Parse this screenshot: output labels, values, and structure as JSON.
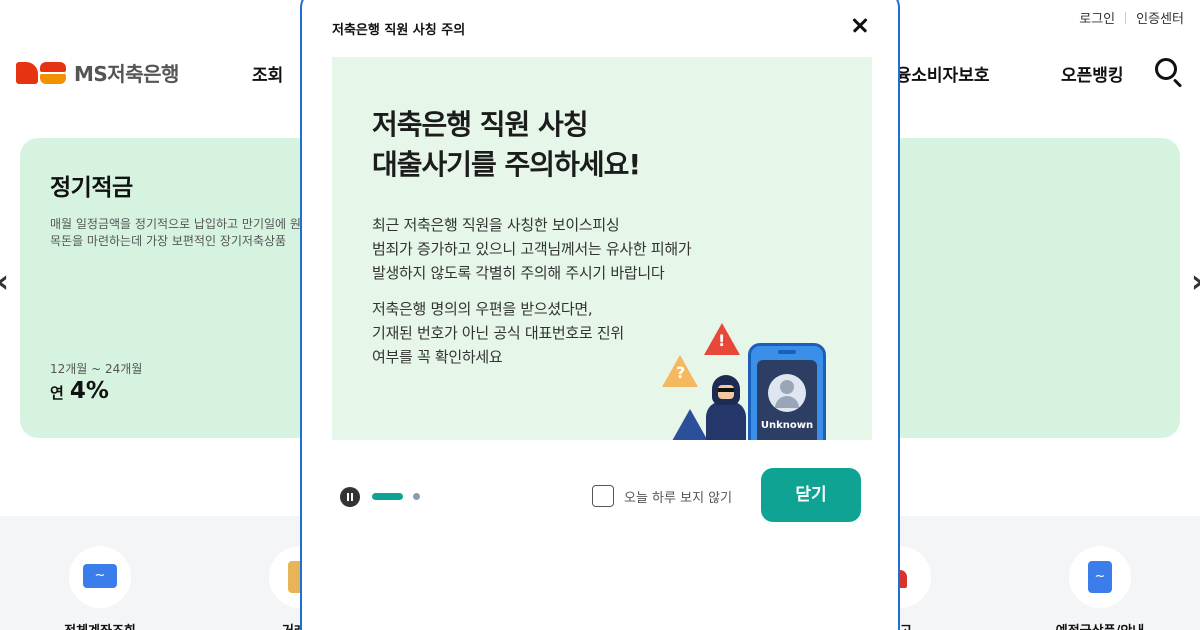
{
  "util_links": {
    "login": "로그인",
    "cert_center": "인증센터"
  },
  "logo": {
    "text": "MS저축은행"
  },
  "nav": {
    "item_inquiry": "조회",
    "item_consumer": "금융소비자보호",
    "item_open_banking": "오픈뱅킹"
  },
  "icons": {
    "search": "search-icon",
    "close": "close-icon",
    "pause": "pause-icon",
    "arrow_left": "chevron-left-icon",
    "arrow_right": "chevron-right-icon"
  },
  "banner": {
    "title": "정기적금",
    "description_line1": "매월 일정금액을 정기적으로 납입하고 만기일에 원",
    "description_line2": "목돈을 마련하는데 가장 보편적인 장기저축상품",
    "period": "12개월 ~ 24개월",
    "rate_label": "연",
    "rate_value": "4%"
  },
  "quick_menu": [
    {
      "label": "전체계좌조회",
      "icon": "account-icon"
    },
    {
      "label": "거래내",
      "icon": "transaction-icon"
    },
    {
      "label": "신고",
      "icon": "siren-icon"
    },
    {
      "label": "예적금상품/안내",
      "icon": "product-guide-icon"
    }
  ],
  "modal": {
    "title": "저축은행 직원 사칭 주의",
    "heading_line1": "저축은행 직원 사칭",
    "heading_line2": "대출사기를 주의하세요!",
    "body_p1_line1": "최근 저축은행 직원을 사칭한 보이스피싱",
    "body_p1_line2": "범죄가 증가하고 있으니 고객님께서는 유사한 피해가",
    "body_p1_line3": "발생하지 않도록 각별히 주의해 주시기 바랍니다",
    "body_p2_line1": "저축은행 명의의 우편을 받으셨다면,",
    "body_p2_line2": "기재된 번호가 아닌 공식 대표번호로 진위",
    "body_p2_line3": "여부를 꼭 확인하세요",
    "phone_label": "Unknown",
    "warn_symbol": "!",
    "question_symbol": "?",
    "no_show_today": "오늘 하루 보지 않기",
    "close_button": "닫기"
  },
  "colors": {
    "accent": "#0fa393",
    "banner_bg": "#d6f3e0",
    "slide_bg": "#e6f7ea",
    "modal_border": "#1f6fd6",
    "brand_red": "#e63312",
    "brand_orange": "#f29100"
  }
}
